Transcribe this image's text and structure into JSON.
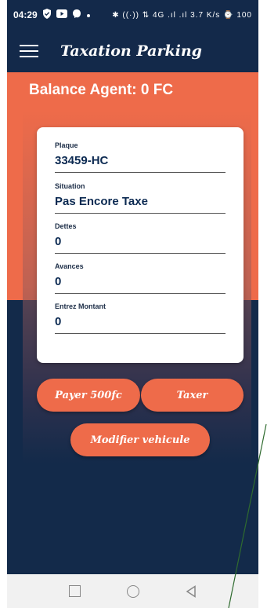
{
  "status_bar": {
    "time": "04:29",
    "icons_left": [
      "shield-check-icon",
      "youtube-icon",
      "messenger-icon",
      "dot-icon"
    ],
    "icons_right_text": "✱ ((·)) ⇅ 4G .ıl .ıl 3.7 K/s ⌚ 100"
  },
  "app_bar": {
    "title": "Taxation Parking"
  },
  "balance": {
    "text": "Balance Agent:  0  FC"
  },
  "form": {
    "fields": [
      {
        "label": "Plaque",
        "value": "33459-HC"
      },
      {
        "label": "Situation",
        "value": "Pas Encore Taxe"
      },
      {
        "label": "Dettes",
        "value": "0"
      },
      {
        "label": "Avances",
        "value": "0"
      },
      {
        "label": "Entrez Montant",
        "value": "0"
      }
    ]
  },
  "buttons": {
    "pay": "Payer 500fc",
    "tax": "Taxer",
    "modify": "Modifier vehicule"
  },
  "colors": {
    "primary_dark": "#13294a",
    "accent_orange": "#ee6b4a",
    "card": "#ffffff"
  }
}
